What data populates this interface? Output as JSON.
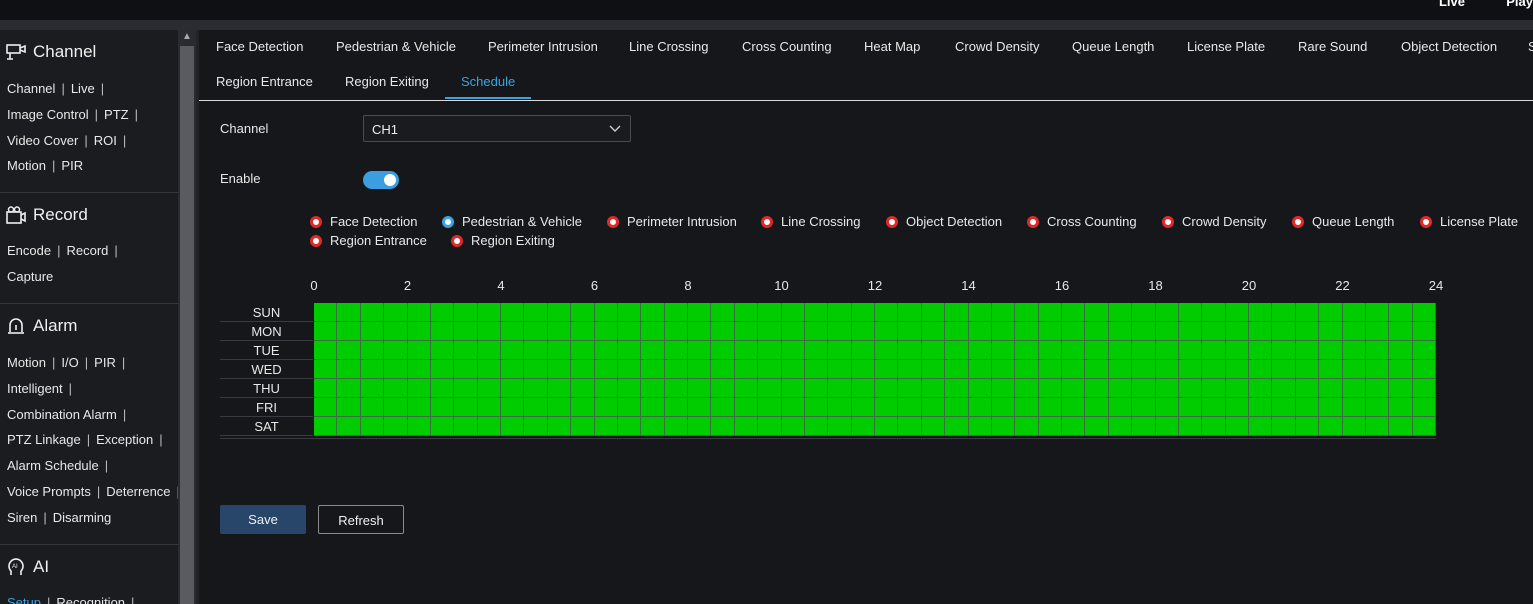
{
  "top_nav": {
    "live": "Live",
    "playback": "Play"
  },
  "sidebar": {
    "sections": [
      {
        "title": "Channel",
        "icon": "camera-icon",
        "rows": [
          [
            "Channel",
            "Live"
          ],
          [
            "Image Control",
            "PTZ"
          ],
          [
            "Video Cover",
            "ROI"
          ],
          [
            "Motion",
            "PIR"
          ]
        ]
      },
      {
        "title": "Record",
        "icon": "record-icon",
        "rows": [
          [
            "Encode",
            "Record"
          ],
          [
            "Capture"
          ]
        ]
      },
      {
        "title": "Alarm",
        "icon": "alarm-icon",
        "rows": [
          [
            "Motion",
            "I/O",
            "PIR"
          ],
          [
            "Intelligent"
          ],
          [
            "Combination Alarm"
          ],
          [
            "PTZ Linkage",
            "Exception"
          ],
          [
            "Alarm Schedule"
          ],
          [
            "Voice Prompts",
            "Deterrence"
          ],
          [
            "Siren",
            "Disarming"
          ]
        ]
      },
      {
        "title": "AI",
        "icon": "ai-head-icon",
        "rows": [
          [
            "Setup",
            "Recognition"
          ]
        ]
      }
    ]
  },
  "tabs": {
    "row1": [
      "Face Detection",
      "Pedestrian & Vehicle",
      "Perimeter Intrusion",
      "Line Crossing",
      "Cross Counting",
      "Heat Map",
      "Crowd Density",
      "Queue Length",
      "License Plate",
      "Rare Sound",
      "Object Detection",
      "S"
    ],
    "row2": [
      "Region Entrance",
      "Region Exiting",
      "Schedule"
    ],
    "active": "Schedule"
  },
  "form": {
    "channel_label": "Channel",
    "channel_value": "CH1",
    "enable_label": "Enable",
    "enable_on": true
  },
  "event_types": {
    "items": [
      "Face Detection",
      "Pedestrian & Vehicle",
      "Perimeter Intrusion",
      "Line Crossing",
      "Object Detection",
      "Cross Counting",
      "Crowd Density",
      "Queue Length",
      "License Plate",
      "Region Entrance",
      "Region Exiting"
    ],
    "selected": "Pedestrian & Vehicle"
  },
  "schedule": {
    "hour_labels": [
      "0",
      "2",
      "4",
      "6",
      "8",
      "10",
      "12",
      "14",
      "16",
      "18",
      "20",
      "22",
      "24"
    ],
    "days": [
      "SUN",
      "MON",
      "TUE",
      "WED",
      "THU",
      "FRI",
      "SAT"
    ],
    "half_hour_slots": 48,
    "all_enabled": true,
    "enabled_color": "#00cc00"
  },
  "buttons": {
    "save": "Save",
    "refresh": "Refresh"
  },
  "colors": {
    "accent": "#3aa3e0",
    "radio_unselected": "#e02a2a",
    "background": "#16171b"
  }
}
